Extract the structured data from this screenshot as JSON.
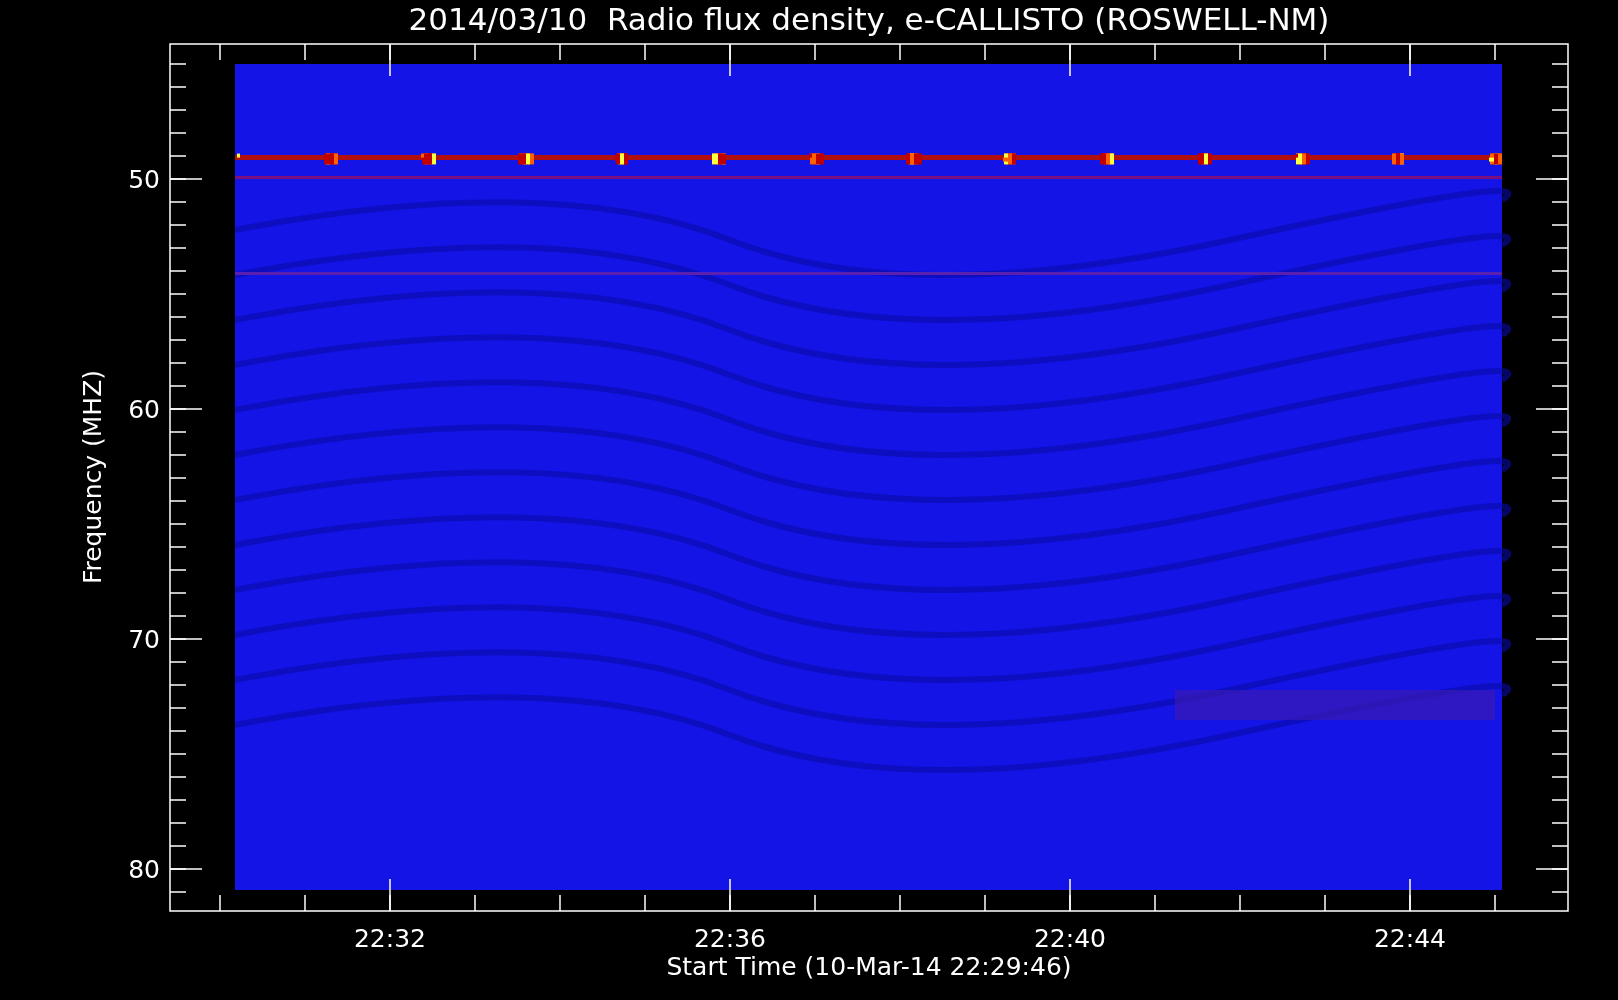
{
  "title": "2014/03/10  Radio flux density, e-CALLISTO (ROSWELL-NM)",
  "y_axis": {
    "label": "Frequency (MHZ)",
    "ticks": [
      "50",
      "60",
      "70",
      "80"
    ]
  },
  "x_axis": {
    "label": "Start Time (10-Mar-14 22:29:46)",
    "ticks": [
      "22:32",
      "22:36",
      "22:40",
      "22:44"
    ]
  }
}
